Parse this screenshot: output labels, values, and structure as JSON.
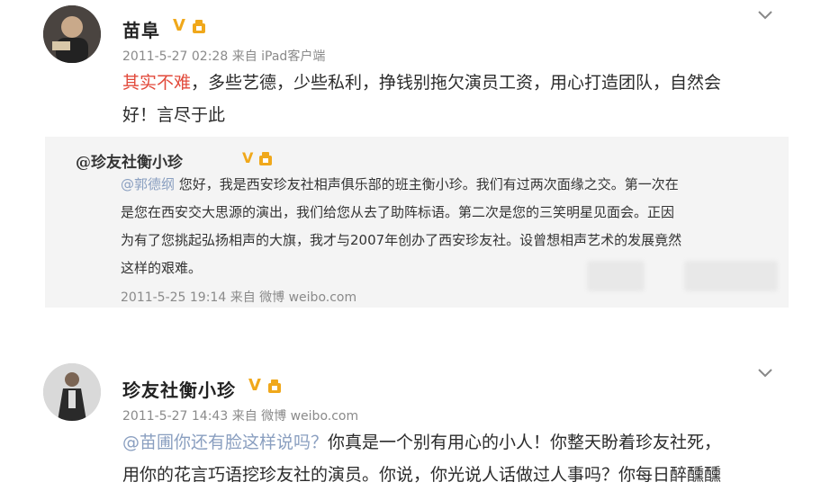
{
  "post1": {
    "author": "苗阜",
    "verified_badge": "V",
    "rank_icon": "rank-icon",
    "timestamp": "2011-5-27 02:28",
    "source": "来自 iPad客户端",
    "highlight": "其实不难",
    "text_line1": "，多些艺德，少些私利，挣钱别拖欠演员工资，用心打造团队，自然会",
    "text_line2": "好！言尽于此",
    "quote": {
      "author": "@珍友社衡小珍",
      "mention": "@郭德纲",
      "line1": " 您好，我是西安珍友社相声俱乐部的班主衡小珍。我们有过两次面缘之交。第一次在",
      "line2": "是您在西安交大思源的演出，我们给您从去了助阵标语。第二次是您的三笑明星见面会。正因",
      "line3": "为有了您挑起弘扬相声的大旗，我才与2007年创办了西安珍友社。设曾想相声艺术的发展竟然",
      "line4": "这样的艰难。",
      "timestamp": "2011-5-25 19:14",
      "source": "来自 微博 weibo.com"
    }
  },
  "post2": {
    "author": "珍友社衡小珍",
    "verified_badge": "V",
    "rank_icon": "rank-icon",
    "timestamp": "2011-5-27 14:43",
    "source": "来自 微博 weibo.com",
    "mention": "@苗圃你还有脸这样说吗？",
    "text_line1": "你真是一个别有用心的小人！你整天盼着珍友社死，",
    "text_line2": "用你的花言巧语挖珍友社的演员。你说，你光说人话做过人事吗？你每日醉醺醺"
  },
  "colors": {
    "highlight_red": "#e24a3b",
    "mention_blue": "#8a9fc0",
    "badge_gold": "#f0a81b"
  }
}
